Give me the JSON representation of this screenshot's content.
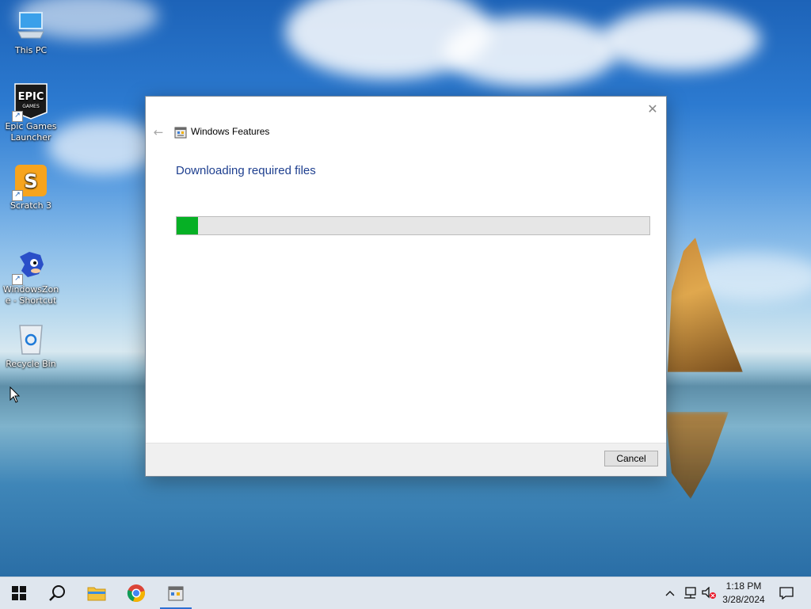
{
  "desktop": {
    "icons": [
      {
        "label": "This PC",
        "icon": "computer-icon"
      },
      {
        "label": "Epic Games Launcher",
        "icon": "epic-games-icon"
      },
      {
        "label": "Scratch 3",
        "icon": "scratch-icon"
      },
      {
        "label": "WindowsZone - Shortcut",
        "icon": "sonic-icon"
      },
      {
        "label": "Recycle Bin",
        "icon": "recycle-bin-icon"
      }
    ]
  },
  "dialog": {
    "title": "Windows Features",
    "heading": "Downloading required files",
    "progress": 0.045,
    "progress_color": "#06b025",
    "cancel_label": "Cancel",
    "close_glyph": "✕",
    "back_glyph": "←"
  },
  "taskbar": {
    "pinned": [
      "windows-start-icon",
      "search-icon",
      "file-explorer-icon",
      "chrome-icon",
      "windows-features-icon"
    ],
    "tray": {
      "time": "1:18 PM",
      "date": "3/28/2024"
    }
  }
}
